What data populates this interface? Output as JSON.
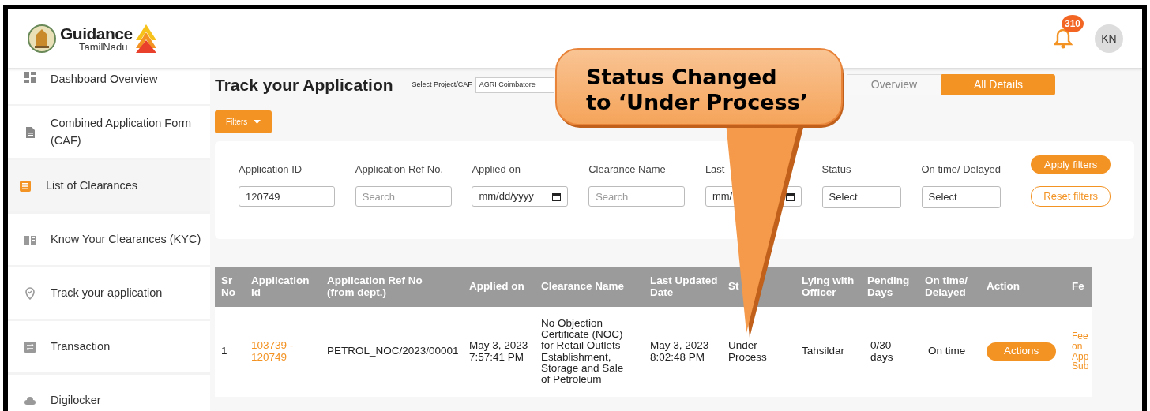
{
  "header": {
    "logo_title": "Guidance",
    "logo_subtitle": "TamilNadu",
    "notification_count": "310",
    "avatar_initials": "KN"
  },
  "sidebar": {
    "items": [
      {
        "label": "Dashboard Overview",
        "selected": false
      },
      {
        "label": "Combined Application Form (CAF)",
        "selected": false
      },
      {
        "label": "List of Clearances",
        "selected": true
      },
      {
        "label": "Know Your Clearances (KYC)",
        "selected": false
      },
      {
        "label": "Track your application",
        "selected": false
      },
      {
        "label": "Transaction",
        "selected": false
      },
      {
        "label": "Digilocker",
        "selected": false
      }
    ]
  },
  "page": {
    "title": "Track your Application",
    "project_select": {
      "label": "Select Project/CAF",
      "value": "AGRI Coimbatore"
    },
    "view_tabs": [
      {
        "label": "Overview",
        "selected": false
      },
      {
        "label": "All Details",
        "selected": true
      }
    ],
    "filters_button": "Filters"
  },
  "filters": {
    "fields": [
      {
        "label": "Application ID",
        "kind": "text",
        "value": "120749"
      },
      {
        "label": "Application Ref No.",
        "kind": "text",
        "placeholder": "Search"
      },
      {
        "label": "Applied on",
        "kind": "date",
        "value": "mm/dd/yyyy"
      },
      {
        "label": "Clearance Name",
        "kind": "text",
        "placeholder": "Search"
      },
      {
        "label": "Last",
        "kind": "date",
        "value": "mm/"
      },
      {
        "label": "Status",
        "kind": "select",
        "value": "Select"
      },
      {
        "label": "On time/ Delayed",
        "kind": "select",
        "value": "Select"
      }
    ],
    "apply_button": "Apply filters",
    "reset_button": "Reset filters"
  },
  "table": {
    "columns": [
      "Sr No",
      "Application Id",
      "Application Ref No (from dept.)",
      "Applied on",
      "Clearance Name",
      "Last Updated Date",
      "St",
      "Lying with Officer",
      "Pending Days",
      "On time/ Delayed",
      "Action",
      "Fe"
    ],
    "rows": [
      {
        "sr_no": "1",
        "application_id": "103739 - 120749",
        "ref_no": "PETROL_NOC/2023/00001",
        "applied_on": "May 3, 2023 7:57:41 PM",
        "clearance_name": "No Objection Certificate (NOC) for Retail Outlets – Establishment, Storage and Sale of Petroleum",
        "last_updated": "May 3, 2023 8:02:48 PM",
        "status": "Under Process",
        "lying_with": "Tahsildar",
        "pending_days": "0/30 days",
        "on_time": "On time",
        "action": "Actions",
        "fee": "Fee on App Sub"
      }
    ]
  },
  "callout": {
    "lines": [
      "Status Changed",
      "to ‘Under Process’"
    ]
  }
}
